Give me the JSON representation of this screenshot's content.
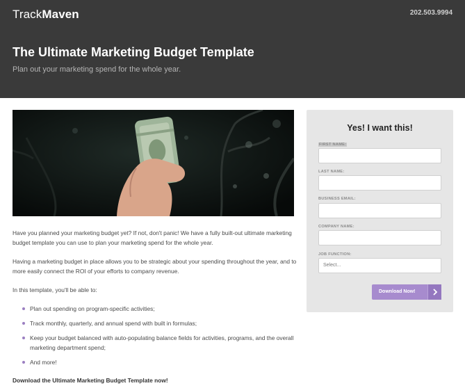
{
  "header": {
    "logo_light": "Track",
    "logo_bold": "Maven",
    "phone": "202.503.9994",
    "title": "The Ultimate Marketing Budget Template",
    "subtitle": "Plan out your marketing spend for the whole year."
  },
  "hero": {
    "icon": "hand-holding-money-image",
    "colors": {
      "background": "#0f1412",
      "bill": "#9fb59a",
      "hand": "#d9a58a"
    }
  },
  "content": {
    "paragraph_1": "Have you planned your marketing budget yet? If not, don't panic! We have a fully built-out ultimate marketing budget template you can use to plan your marketing spend for the whole year.",
    "paragraph_2": "Having a marketing budget in place allows you to be strategic about your spending throughout the year, and to more easily connect the ROI of your efforts to company revenue.",
    "paragraph_3": "In this template, you'll be able to:",
    "bullets": [
      "Plan out spending on program-specific activities;",
      "Track monthly, quarterly, and annual spend with built in formulas;",
      "Keep your budget balanced with auto-populating balance fields for activities, programs, and the overall marketing department spend;",
      "And more!"
    ],
    "cta_text": "Download the Ultimate Marketing Budget Template now!"
  },
  "form": {
    "title": "Yes! I want this!",
    "fields": [
      {
        "label": "FIRST NAME:",
        "value": ""
      },
      {
        "label": "LAST NAME:",
        "value": ""
      },
      {
        "label": "BUSINESS EMAIL:",
        "value": ""
      },
      {
        "label": "COMPANY NAME:",
        "value": ""
      }
    ],
    "job_function": {
      "label": "JOB FUNCTION:",
      "selected": "Select..."
    },
    "button_label": "Download Now!",
    "button_icon": "chevron-right-icon",
    "colors": {
      "accent": "#a78bce",
      "card": "#e6e6e6"
    }
  }
}
